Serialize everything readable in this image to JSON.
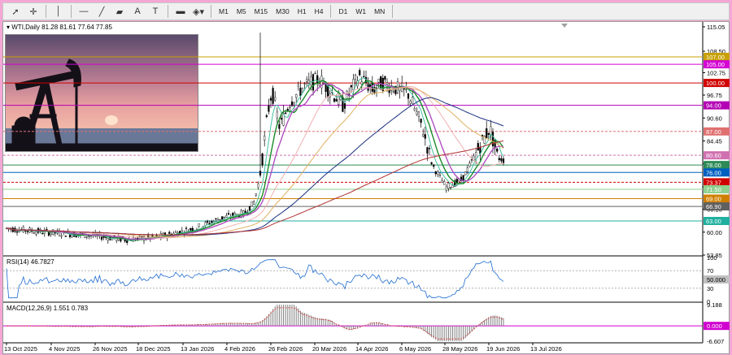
{
  "toolbar": {
    "tools": [
      {
        "name": "cursor-icon",
        "glyph": "➚"
      },
      {
        "name": "crosshair-icon",
        "glyph": "✛"
      },
      {
        "name": "vertical-line-icon",
        "glyph": "│"
      },
      {
        "name": "horizontal-line-icon",
        "glyph": "—"
      },
      {
        "name": "trendline-icon",
        "glyph": "╱"
      },
      {
        "name": "channel-icon",
        "glyph": "▰"
      },
      {
        "name": "text-icon",
        "glyph": "A"
      },
      {
        "name": "text-label-icon",
        "glyph": "T"
      },
      {
        "name": "rectangle-icon",
        "glyph": "▬"
      },
      {
        "name": "shapes-dropdown-icon",
        "glyph": "◈▾"
      }
    ],
    "timeframes": [
      "M1",
      "M5",
      "M15",
      "M30",
      "H1",
      "H4",
      "D1",
      "W1",
      "MN"
    ]
  },
  "chart": {
    "symbol_label": "WTI,Daily",
    "ohlc": "81.28 81.61 77.64 77.85",
    "rsi_label": "RSI(14) 46.7827",
    "macd_label": "MACD(12,26,9) 1.551 0.783",
    "price_axis": [
      "115.05",
      "108.50",
      "102.75",
      "96.75",
      "90.60",
      "84.45",
      "78.30",
      "72.15",
      "66.15",
      "60.00",
      "53.85"
    ],
    "rsi_axis": [
      "100",
      "70",
      "50.000",
      "30",
      "0"
    ],
    "macd_axis": [
      "9.188",
      "0.000",
      "-6.607"
    ],
    "level_tags": [
      {
        "text": "107.00",
        "color": "#c8a000"
      },
      {
        "text": "105.00",
        "color": "#d400d4"
      },
      {
        "text": "100.00",
        "color": "#d00000"
      },
      {
        "text": "94.00",
        "color": "#b400b4"
      },
      {
        "text": "87.00",
        "color": "#e07070"
      },
      {
        "text": "80.60",
        "color": "#d070b0"
      },
      {
        "text": "78.00",
        "color": "#2e8b57"
      },
      {
        "text": "76.00",
        "color": "#0060c0"
      },
      {
        "text": "73.37",
        "color": "#d00000"
      },
      {
        "text": "71.50",
        "color": "#8fd08f"
      },
      {
        "text": "69.00",
        "color": "#d08000"
      },
      {
        "text": "66.90",
        "color": "#606060"
      },
      {
        "text": "63.00",
        "color": "#20b0a0"
      }
    ],
    "date_axis": [
      "13 Oct 2025",
      "4 Nov 2025",
      "26 Nov 2025",
      "18 Dec 2025",
      "13 Jan 2026",
      "4 Feb 2026",
      "26 Feb 2026",
      "20 Mar 2026",
      "14 Apr 2026",
      "6 May 2026",
      "28 May 2026",
      "19 Jun 2026",
      "13 Jul 2026"
    ]
  }
}
